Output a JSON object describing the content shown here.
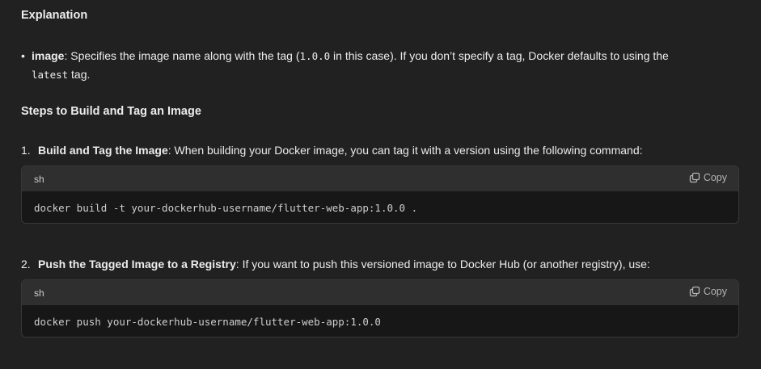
{
  "explanation": {
    "title": "Explanation",
    "bullet": {
      "term": "image",
      "text_before": ": Specifies the image name along with the tag (",
      "inline_code": "1.0.0",
      "text_after": " in this case). If you don’t specify a tag, Docker defaults to using the",
      "inline_code2": "latest",
      "text_end": " tag."
    }
  },
  "steps": {
    "title": "Steps to Build and Tag an Image",
    "items": [
      {
        "number": "1.",
        "title": "Build and Tag the Image",
        "text": ": When building your Docker image, you can tag it with a version using the following command:",
        "code_lang": "sh",
        "copy_label": "Copy",
        "code": "docker build -t your-dockerhub-username/flutter-web-app:1.0.0 ."
      },
      {
        "number": "2.",
        "title": "Push the Tagged Image to a Registry",
        "text": ": If you want to push this versioned image to Docker Hub (or another registry), use:",
        "code_lang": "sh",
        "copy_label": "Copy",
        "code": "docker push your-dockerhub-username/flutter-web-app:1.0.0"
      }
    ]
  }
}
